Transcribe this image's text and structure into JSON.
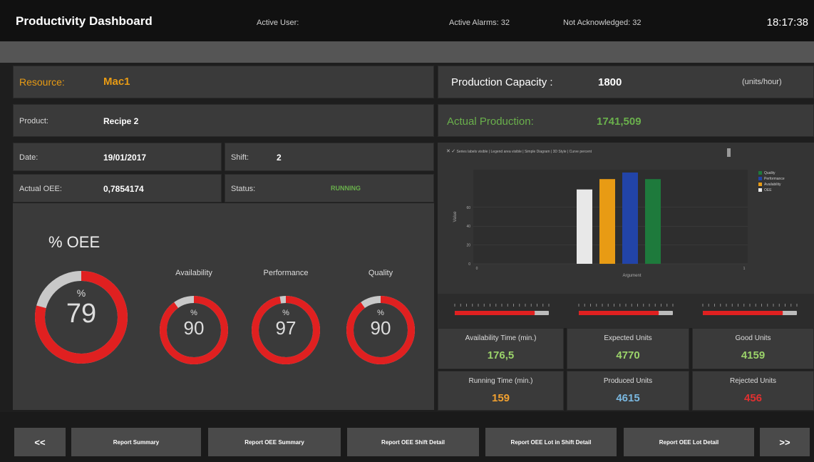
{
  "header": {
    "title": "Productivity Dashboard",
    "active_user": "Active User:",
    "active_alarms": "Active Alarms: 32",
    "not_acknowledged": "Not Acknowledged: 32",
    "clock": "18:17:38"
  },
  "resource": {
    "label": "Resource:",
    "value": "Mac1"
  },
  "product": {
    "label": "Product:",
    "value": "Recipe 2"
  },
  "date": {
    "label": "Date:",
    "value": "19/01/2017"
  },
  "shift": {
    "label": "Shift:",
    "value": "2"
  },
  "actual_oee": {
    "label": "Actual OEE:",
    "value": "0,7854174"
  },
  "status": {
    "label": "Status:",
    "value": "RUNNING"
  },
  "capacity": {
    "label": "Production Capacity :",
    "value": "1800",
    "unit": "(units/hour)"
  },
  "actual_production": {
    "label": "Actual Production:",
    "value": "1741,509"
  },
  "gauges": {
    "title": "% OEE",
    "percent_symbol": "%",
    "oee": {
      "value": "79",
      "fraction": 0.79
    },
    "availability": {
      "label": "Availability",
      "value": "90",
      "fraction": 0.9
    },
    "performance": {
      "label": "Performance",
      "value": "97",
      "fraction": 0.97
    },
    "quality": {
      "label": "Quality",
      "value": "90",
      "fraction": 0.9
    }
  },
  "chart_toolbar": {
    "items": [
      "Series labels visible",
      "Legend area visible",
      "Simple Diagram",
      "3D Style",
      "Curve percent"
    ]
  },
  "chart_data": {
    "type": "bar",
    "xlabel": "Argument",
    "ylabel": "Value",
    "legend_position": "top-right",
    "legend_names": [
      "Quality",
      "Performance",
      "Availability",
      "OEE"
    ],
    "colors": [
      "#1e7a3c",
      "#2244a8",
      "#e89b14",
      "#e8e8e8"
    ],
    "ylim": [
      0,
      100
    ],
    "y_ticks": [
      "0",
      "20",
      "40",
      "60"
    ],
    "x_ticks": [
      "0",
      "1"
    ],
    "series": [
      {
        "value": 79,
        "color": "#e8e8e8"
      },
      {
        "value": 90,
        "color": "#e89b14"
      },
      {
        "value": 97,
        "color": "#2244a8"
      },
      {
        "value": 90,
        "color": "#1e7a3c"
      }
    ]
  },
  "tiles": [
    {
      "label": "Availability Time (min.)",
      "value": "176,5",
      "color": "#9bd36a"
    },
    {
      "label": "Expected Units",
      "value": "4770",
      "color": "#9bd36a"
    },
    {
      "label": "Good Units",
      "value": "4159",
      "color": "#9bd36a"
    },
    {
      "label": "Running Time (min.)",
      "value": "159",
      "color": "#f0a030"
    },
    {
      "label": "Produced Units",
      "value": "4615",
      "color": "#7ab8e0"
    },
    {
      "label": "Rejected Units",
      "value": "456",
      "color": "#e03030"
    }
  ],
  "sliders": [
    0.85,
    0.85,
    0.85
  ],
  "buttons": {
    "prev": "<<",
    "next": ">>",
    "report_summary": "Report Summary",
    "report_oee_summary": "Report OEE Summary",
    "report_oee_shift_detail": "Report OEE Shift Detail",
    "report_oee_lot_in_shift_detail": "Report OEE Lot in Shift Detail",
    "report_oee_lot_detail": "Report OEE Lot Detail"
  }
}
